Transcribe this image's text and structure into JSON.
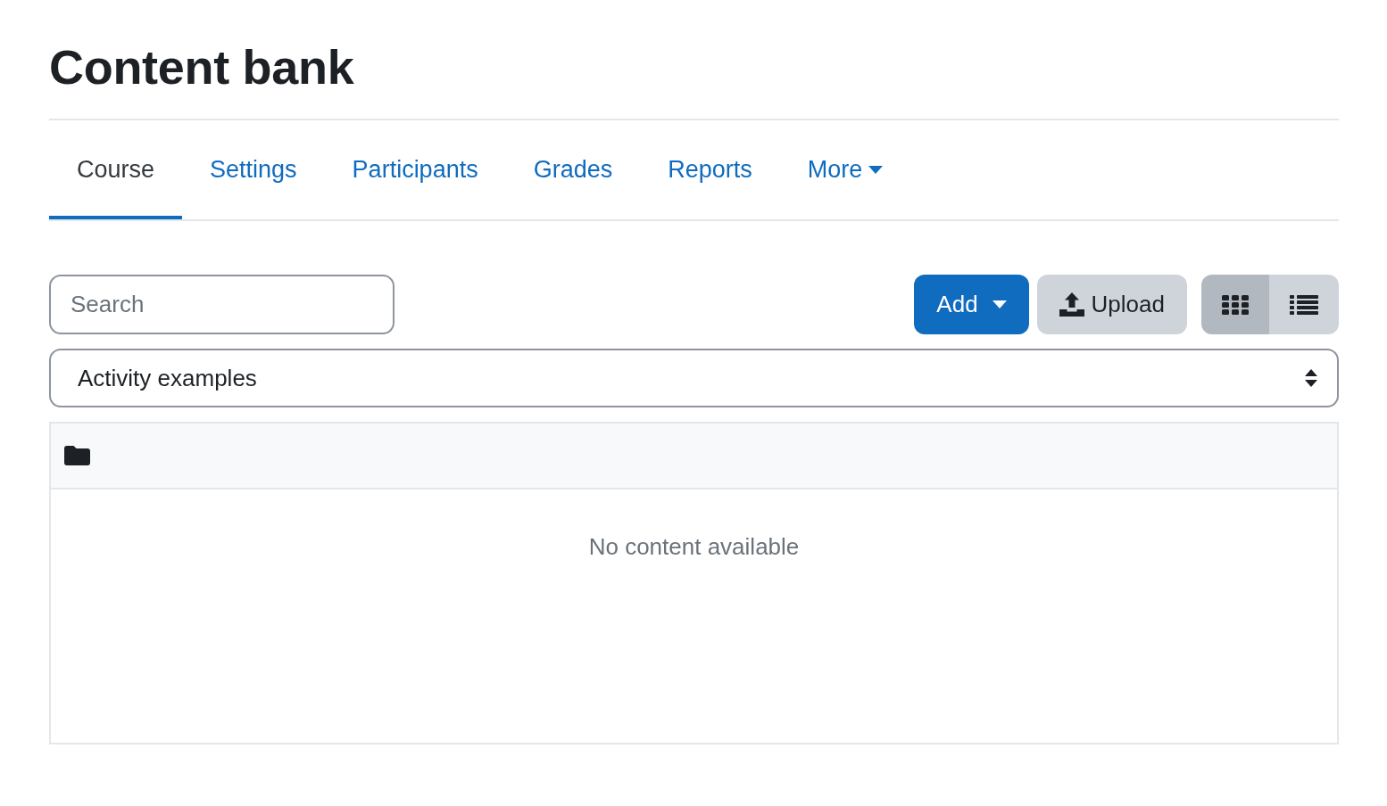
{
  "page": {
    "title": "Content bank"
  },
  "tabs": [
    {
      "label": "Course",
      "selected": true,
      "kind": "link"
    },
    {
      "label": "Settings",
      "selected": false,
      "kind": "link"
    },
    {
      "label": "Participants",
      "selected": false,
      "kind": "link"
    },
    {
      "label": "Grades",
      "selected": false,
      "kind": "link"
    },
    {
      "label": "Reports",
      "selected": false,
      "kind": "link"
    },
    {
      "label": "More",
      "selected": false,
      "kind": "dropdown"
    }
  ],
  "search": {
    "placeholder": "Search"
  },
  "buttons": [
    {
      "label": "Add",
      "kind": "add"
    },
    {
      "label": "Upload",
      "kind": "upload"
    }
  ],
  "view_toggle": [
    {
      "kind": "grid",
      "selected": true
    },
    {
      "kind": "list",
      "selected": false
    }
  ],
  "context_select": {
    "value": "Activity examples"
  },
  "content": {
    "empty_message": "No content available"
  }
}
